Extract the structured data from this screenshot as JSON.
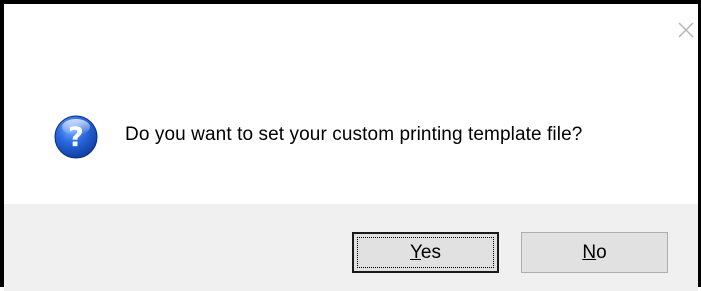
{
  "dialog": {
    "message": "Do you want to set your custom printing template file?",
    "icon": "question-icon",
    "close_icon": "close-icon"
  },
  "buttons": {
    "yes": {
      "mnemonic": "Y",
      "rest": "es",
      "default": true
    },
    "no": {
      "mnemonic": "N",
      "rest": "o",
      "default": false
    }
  },
  "colors": {
    "button_bar": "#f0f0f0",
    "button_face": "#e1e1e1",
    "icon_blue": "#1d57c4"
  }
}
